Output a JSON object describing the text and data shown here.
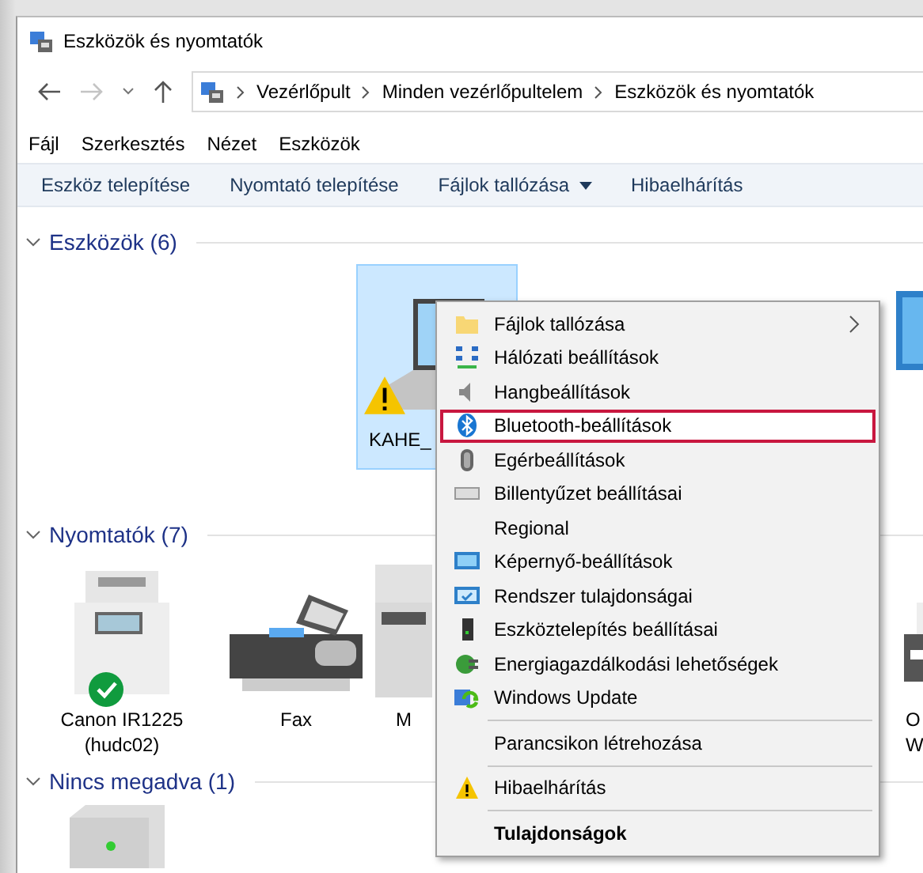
{
  "window": {
    "title": "Eszközök és nyomtatók"
  },
  "address": {
    "crumbs": [
      "Vezérlőpult",
      "Minden vezérlőpultelem",
      "Eszközök és nyomtatók"
    ]
  },
  "menu_bar": [
    "Fájl",
    "Szerkesztés",
    "Nézet",
    "Eszközök"
  ],
  "command_bar": [
    {
      "label": "Eszköz telepítése",
      "dropdown": false
    },
    {
      "label": "Nyomtató telepítése",
      "dropdown": false
    },
    {
      "label": "Fájlok tallózása",
      "dropdown": true
    },
    {
      "label": "Hibaelhárítás",
      "dropdown": false
    }
  ],
  "groups": [
    {
      "title": "Eszközök (6)",
      "expanded": true,
      "items": [
        {
          "kind": "laptop",
          "label": "KAHE_",
          "selected": true,
          "warning": true
        },
        {
          "kind": "monitor",
          "selected": false
        }
      ]
    },
    {
      "title": "Nyomtatók (7)",
      "expanded": true,
      "items": [
        {
          "kind": "mfp",
          "label": "Canon IR1225 (hudc02)",
          "selected": false,
          "ok": true
        },
        {
          "kind": "fax",
          "label": "Fax",
          "selected": false
        },
        {
          "kind": "copier",
          "label": "M",
          "selected": false
        },
        {
          "kind": "printer",
          "label": "O W",
          "selected": false
        }
      ]
    },
    {
      "title": "Nincs megadva (1)",
      "expanded": true,
      "items": [
        {
          "kind": "box",
          "selected": false
        }
      ]
    }
  ],
  "context_menu": {
    "items": [
      {
        "kind": "item",
        "label": "Fájlok tallózása",
        "submenu": true,
        "selected": false,
        "default": false
      },
      {
        "kind": "item",
        "label": "Hálózati beállítások",
        "submenu": false,
        "selected": false,
        "default": false
      },
      {
        "kind": "item",
        "label": "Hangbeállítások",
        "submenu": false,
        "selected": false,
        "default": false
      },
      {
        "kind": "item",
        "label": "Bluetooth-beállítások",
        "submenu": false,
        "selected": true,
        "default": false
      },
      {
        "kind": "item",
        "label": "Egérbeállítások",
        "submenu": false,
        "selected": false,
        "default": false
      },
      {
        "kind": "item",
        "label": "Billentyűzet beállításai",
        "submenu": false,
        "selected": false,
        "default": false
      },
      {
        "kind": "item",
        "label": "Regional",
        "submenu": false,
        "selected": false,
        "default": false
      },
      {
        "kind": "item",
        "label": "Képernyő-beállítások",
        "submenu": false,
        "selected": false,
        "default": false
      },
      {
        "kind": "item",
        "label": "Rendszer tulajdonságai",
        "submenu": false,
        "selected": false,
        "default": false
      },
      {
        "kind": "item",
        "label": "Eszköztelepítés beállításai",
        "submenu": false,
        "selected": false,
        "default": false
      },
      {
        "kind": "item",
        "label": "Energiagazdálkodási lehetőségek",
        "submenu": false,
        "selected": false,
        "default": false
      },
      {
        "kind": "item",
        "label": "Windows Update",
        "submenu": false,
        "selected": false,
        "default": false
      },
      {
        "kind": "separator"
      },
      {
        "kind": "item",
        "label": "Parancsikon létrehozása",
        "submenu": false,
        "selected": false,
        "default": false
      },
      {
        "kind": "separator"
      },
      {
        "kind": "item",
        "label": "Hibaelhárítás",
        "submenu": false,
        "selected": false,
        "default": false
      },
      {
        "kind": "separator"
      },
      {
        "kind": "item",
        "label": "Tulajdonságok",
        "submenu": false,
        "selected": false,
        "default": true
      }
    ]
  }
}
